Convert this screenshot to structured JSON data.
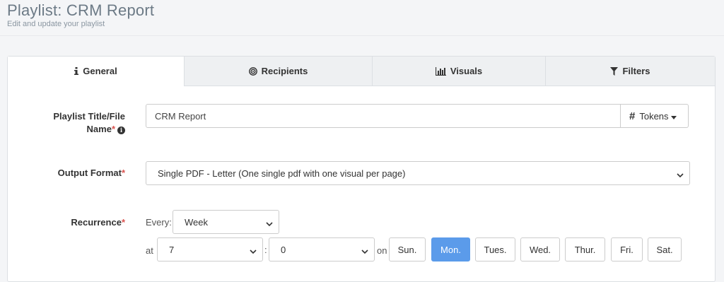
{
  "header": {
    "title": "Playlist: CRM Report",
    "subtitle": "Edit and update your playlist"
  },
  "tabs": [
    {
      "label": "General",
      "icon": "info-icon",
      "active": true
    },
    {
      "label": "Recipients",
      "icon": "target-icon",
      "active": false
    },
    {
      "label": "Visuals",
      "icon": "bar-chart-icon",
      "active": false
    },
    {
      "label": "Filters",
      "icon": "filter-icon",
      "active": false
    }
  ],
  "form": {
    "title_label_line1": "Playlist Title/File",
    "title_label_line2": "Name",
    "title_value": "CRM Report",
    "tokens_label": "Tokens",
    "output_label": "Output Format",
    "output_value": "Single PDF - Letter (One single pdf with one visual per page)",
    "recurrence_label": "Recurrence",
    "every_label": "Every:",
    "every_value": "Week",
    "at_label": "at",
    "hour_value": "7",
    "colon": ":",
    "minute_value": "0",
    "on_label": "on",
    "required_mark": "*",
    "days": [
      {
        "label": "Sun.",
        "selected": false
      },
      {
        "label": "Mon.",
        "selected": true
      },
      {
        "label": "Tues.",
        "selected": false
      },
      {
        "label": "Wed.",
        "selected": false
      },
      {
        "label": "Thur.",
        "selected": false
      },
      {
        "label": "Fri.",
        "selected": false
      },
      {
        "label": "Sat.",
        "selected": false
      }
    ]
  },
  "colors": {
    "accent": "#5b9bea",
    "required": "#d9534f"
  }
}
